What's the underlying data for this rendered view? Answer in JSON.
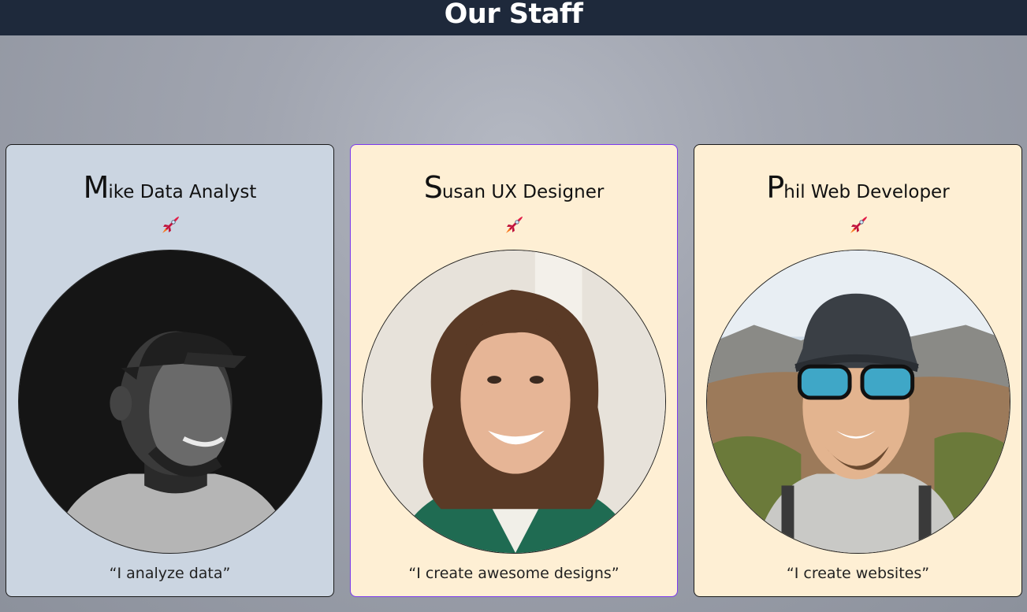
{
  "page": {
    "title": "Our Staff"
  },
  "staff": [
    {
      "initial": "M",
      "rest_of_name": "ike",
      "role": "Data Analyst",
      "quote": "“I analyze data”",
      "icon": "rocket-icon",
      "background": "#cbd5e1"
    },
    {
      "initial": "S",
      "rest_of_name": "usan",
      "role": "UX Designer",
      "quote": "“I create awesome designs”",
      "icon": "rocket-icon",
      "background": "#feefd4"
    },
    {
      "initial": "P",
      "rest_of_name": "hil",
      "role": "Web Developer",
      "quote": "“I create websites”",
      "icon": "rocket-icon",
      "background": "#feefd4"
    }
  ],
  "colors": {
    "header_bg": "#1e293b",
    "header_text": "#ffffff",
    "rocket_body": "#e11d48",
    "rocket_flame": "#f97316"
  }
}
